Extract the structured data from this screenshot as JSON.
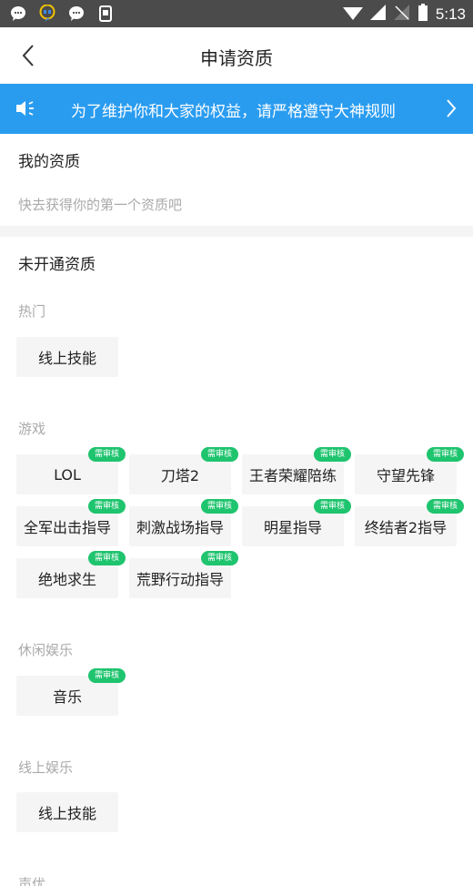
{
  "status_bar": {
    "time": "5:13",
    "icons": [
      "chat-bubble-icon",
      "hangouts-icon",
      "chat-bubble-icon",
      "phone-icon",
      "wifi-icon",
      "signal-icon",
      "no-sim-icon",
      "battery-icon"
    ]
  },
  "header": {
    "title": "申请资质",
    "back_icon": "chevron-left-icon"
  },
  "notice": {
    "text": "为了维护你和大家的权益，请严格遵守大神规则",
    "icon": "speaker-icon",
    "arrow": "chevron-right-icon"
  },
  "my_qualifications": {
    "title": "我的资质",
    "empty_text": "快去获得你的第一个资质吧"
  },
  "unopened": {
    "title": "未开通资质",
    "badge_text": "需审核",
    "categories": [
      {
        "name": "热门",
        "items": [
          "线上技能"
        ]
      },
      {
        "name": "游戏",
        "items": [
          "LOL",
          "刀塔2",
          "王者荣耀陪练",
          "守望先锋",
          "全军出击指导",
          "刺激战场指导",
          "明星指导",
          "终结者2指导",
          "绝地求生",
          "荒野行动指导"
        ]
      },
      {
        "name": "休闲娱乐",
        "items": [
          "音乐"
        ]
      },
      {
        "name": "线上娱乐",
        "items": [
          "线上技能"
        ]
      },
      {
        "name": "声优"
      }
    ]
  },
  "colors": {
    "accent": "#2a9cf0",
    "badge": "#1fc46e",
    "status_bar": "#4b4b4b"
  }
}
